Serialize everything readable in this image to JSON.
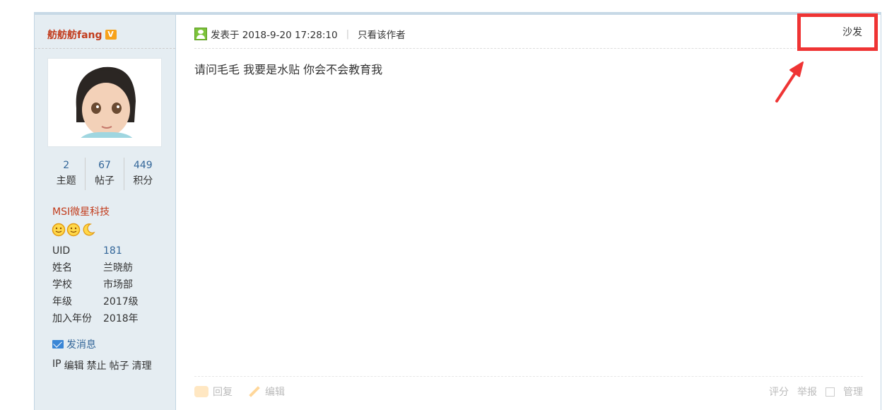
{
  "author": {
    "name": "舫舫舫fang",
    "badge_icon": "v-badge-icon",
    "avatar_alt": "user avatar",
    "stats": [
      {
        "num": "2",
        "label": "主题"
      },
      {
        "num": "67",
        "label": "帖子"
      },
      {
        "num": "449",
        "label": "积分"
      }
    ],
    "group": "MSI微星科技",
    "medals": [
      "smiley-icon",
      "smiley-icon",
      "moon-icon"
    ],
    "profile": [
      {
        "key": "UID",
        "value": "181"
      },
      {
        "key": "姓名",
        "value": "兰晓舫"
      },
      {
        "key": "学校",
        "value": "市场部"
      },
      {
        "key": "年级",
        "value": "2017级"
      },
      {
        "key": "加入年份",
        "value": "2018年"
      }
    ],
    "send_message": "发消息",
    "admin_links": [
      "IP",
      "编辑",
      "禁止",
      "帖子",
      "清理"
    ]
  },
  "post": {
    "posted_at": "发表于 2018-9-20 17:28:10",
    "only_author": "只看该作者",
    "floor": "沙发",
    "content": "请问毛毛 我要是水贴 你会不会教育我",
    "footer": {
      "reply": "回复",
      "edit": "编辑",
      "rate": "评分",
      "report": "举报",
      "manage": "管理"
    }
  },
  "colors": {
    "author_name": "#c23c1c",
    "link": "#336699",
    "sidebar_bg": "#e5edf2",
    "highlight": "#ef3434"
  }
}
